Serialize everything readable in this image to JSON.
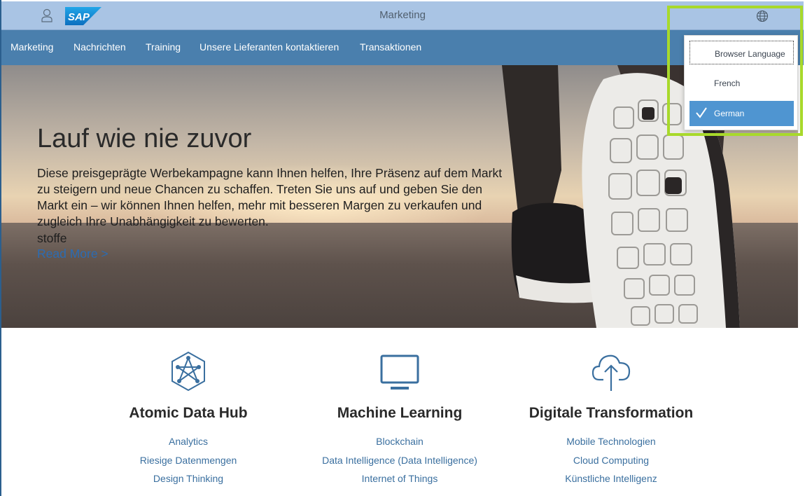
{
  "shell": {
    "title": "Marketing",
    "logo_text": "SAP",
    "icons": {
      "user": "user-icon",
      "language": "globe-icon",
      "logo": "sap-logo"
    }
  },
  "nav": {
    "items": [
      {
        "label": "Marketing"
      },
      {
        "label": "Nachrichten"
      },
      {
        "label": "Training"
      },
      {
        "label": "Unsere Lieferanten kontaktieren"
      },
      {
        "label": "Transaktionen"
      }
    ]
  },
  "hero": {
    "title": "Lauf wie nie zuvor",
    "description": "Diese preisgeprägte Werbekampagne kann Ihnen helfen, Ihre Präsenz auf dem Markt zu steigern und neue Chancen zu schaffen. Treten Sie uns auf und geben Sie den Markt ein – wir können Ihnen helfen, mehr mit besseren Margen zu verkaufen und zugleich Ihre Unabhängigkeit zu bewerten.",
    "extra": "stoffe",
    "read_more": "Read More >"
  },
  "language_menu": {
    "options": [
      {
        "label": "Browser Language",
        "state": "focused"
      },
      {
        "label": "French",
        "state": "normal"
      },
      {
        "label": "German",
        "state": "selected"
      }
    ]
  },
  "features": [
    {
      "title": "Atomic Data Hub",
      "icon": "atom-network-icon",
      "links": [
        "Analytics",
        "Riesige Datenmengen",
        "Design Thinking"
      ]
    },
    {
      "title": "Machine Learning",
      "icon": "monitor-icon",
      "links": [
        "Blockchain",
        "Data Intelligence (Data Intelligence)",
        "Internet of Things"
      ]
    },
    {
      "title": "Digitale Transformation",
      "icon": "cloud-upload-icon",
      "links": [
        "Mobile Technologien",
        "Cloud Computing",
        "Künstliche Intelligenz"
      ]
    }
  ],
  "colors": {
    "shell": "#a9c4e4",
    "nav": "#4a7fad",
    "accent": "#4f95d1",
    "highlight": "#a8d92b",
    "link": "#3a6f9f"
  }
}
